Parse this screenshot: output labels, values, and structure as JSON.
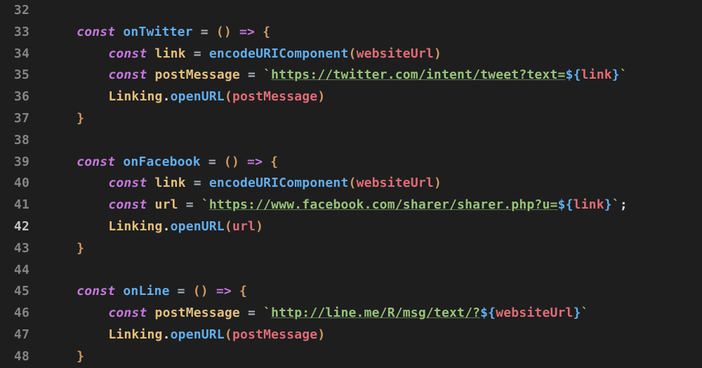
{
  "editor": {
    "font": "Menlo / SF Mono",
    "filename": "share.js",
    "language": "javascript/jsx",
    "indent_unit": "  ",
    "active_line": 42
  },
  "lines": [
    {
      "n": 32,
      "indent": 1,
      "tokens": []
    },
    {
      "n": 33,
      "indent": 1,
      "tokens": [
        {
          "c": "tok-kw",
          "t": "const"
        },
        {
          "c": "tok-pun",
          "t": " "
        },
        {
          "c": "tok-call",
          "t": "onTwitter"
        },
        {
          "c": "tok-pun",
          "t": " "
        },
        {
          "c": "tok-op",
          "t": "="
        },
        {
          "c": "tok-pun",
          "t": " "
        },
        {
          "c": "tok-paren",
          "t": "()"
        },
        {
          "c": "tok-pun",
          "t": " "
        },
        {
          "c": "tok-kw",
          "t": "=>"
        },
        {
          "c": "tok-pun",
          "t": " "
        },
        {
          "c": "tok-paren",
          "t": "{"
        }
      ]
    },
    {
      "n": 34,
      "indent": 2,
      "tokens": [
        {
          "c": "tok-kw",
          "t": "const"
        },
        {
          "c": "tok-pun",
          "t": " "
        },
        {
          "c": "tok-var",
          "t": "link"
        },
        {
          "c": "tok-pun",
          "t": " "
        },
        {
          "c": "tok-op",
          "t": "="
        },
        {
          "c": "tok-pun",
          "t": " "
        },
        {
          "c": "tok-call",
          "t": "encodeURIComponent"
        },
        {
          "c": "tok-paren",
          "t": "("
        },
        {
          "c": "tok-red",
          "t": "websiteUrl"
        },
        {
          "c": "tok-paren",
          "t": ")"
        }
      ]
    },
    {
      "n": 35,
      "indent": 2,
      "tokens": [
        {
          "c": "tok-kw",
          "t": "const"
        },
        {
          "c": "tok-pun",
          "t": " "
        },
        {
          "c": "tok-var",
          "t": "postMessage"
        },
        {
          "c": "tok-pun",
          "t": " "
        },
        {
          "c": "tok-op",
          "t": "="
        },
        {
          "c": "tok-pun",
          "t": " "
        },
        {
          "c": "tok-str",
          "t": "`"
        },
        {
          "c": "tok-url",
          "t": "https://twitter.com/intent/tweet?text="
        },
        {
          "c": "tok-tpl",
          "t": "${"
        },
        {
          "c": "tok-red",
          "t": "link"
        },
        {
          "c": "tok-tpl",
          "t": "}"
        },
        {
          "c": "tok-str",
          "t": "`"
        }
      ]
    },
    {
      "n": 36,
      "indent": 2,
      "tokens": [
        {
          "c": "tok-var",
          "t": "Linking"
        },
        {
          "c": "tok-pun",
          "t": "."
        },
        {
          "c": "tok-call",
          "t": "openURL"
        },
        {
          "c": "tok-paren",
          "t": "("
        },
        {
          "c": "tok-red",
          "t": "postMessage"
        },
        {
          "c": "tok-paren",
          "t": ")"
        }
      ]
    },
    {
      "n": 37,
      "indent": 1,
      "tokens": [
        {
          "c": "tok-paren",
          "t": "}"
        }
      ]
    },
    {
      "n": 38,
      "indent": 0,
      "tokens": []
    },
    {
      "n": 39,
      "indent": 1,
      "tokens": [
        {
          "c": "tok-kw",
          "t": "const"
        },
        {
          "c": "tok-pun",
          "t": " "
        },
        {
          "c": "tok-call",
          "t": "onFacebook"
        },
        {
          "c": "tok-pun",
          "t": " "
        },
        {
          "c": "tok-op",
          "t": "="
        },
        {
          "c": "tok-pun",
          "t": " "
        },
        {
          "c": "tok-paren",
          "t": "()"
        },
        {
          "c": "tok-pun",
          "t": " "
        },
        {
          "c": "tok-kw",
          "t": "=>"
        },
        {
          "c": "tok-pun",
          "t": " "
        },
        {
          "c": "tok-paren",
          "t": "{"
        }
      ]
    },
    {
      "n": 40,
      "indent": 2,
      "tokens": [
        {
          "c": "tok-kw",
          "t": "const"
        },
        {
          "c": "tok-pun",
          "t": " "
        },
        {
          "c": "tok-var",
          "t": "link"
        },
        {
          "c": "tok-pun",
          "t": " "
        },
        {
          "c": "tok-op",
          "t": "="
        },
        {
          "c": "tok-pun",
          "t": " "
        },
        {
          "c": "tok-call",
          "t": "encodeURIComponent"
        },
        {
          "c": "tok-paren",
          "t": "("
        },
        {
          "c": "tok-red",
          "t": "websiteUrl"
        },
        {
          "c": "tok-paren",
          "t": ")"
        }
      ]
    },
    {
      "n": 41,
      "indent": 2,
      "tokens": [
        {
          "c": "tok-kw",
          "t": "const"
        },
        {
          "c": "tok-pun",
          "t": " "
        },
        {
          "c": "tok-var",
          "t": "url"
        },
        {
          "c": "tok-pun",
          "t": " "
        },
        {
          "c": "tok-op",
          "t": "="
        },
        {
          "c": "tok-pun",
          "t": " "
        },
        {
          "c": "tok-str",
          "t": "`"
        },
        {
          "c": "tok-url",
          "t": "https://www.facebook.com/sharer/sharer.php?u="
        },
        {
          "c": "tok-tpl",
          "t": "${"
        },
        {
          "c": "tok-red",
          "t": "link"
        },
        {
          "c": "tok-tpl",
          "t": "}"
        },
        {
          "c": "tok-str",
          "t": "`"
        },
        {
          "c": "tok-pun",
          "t": ";"
        }
      ]
    },
    {
      "n": 42,
      "indent": 2,
      "tokens": [
        {
          "c": "tok-var",
          "t": "Linking"
        },
        {
          "c": "tok-pun",
          "t": "."
        },
        {
          "c": "tok-call",
          "t": "openURL"
        },
        {
          "c": "tok-paren",
          "t": "("
        },
        {
          "c": "tok-red",
          "t": "url"
        },
        {
          "c": "tok-paren",
          "t": ")"
        }
      ]
    },
    {
      "n": 43,
      "indent": 1,
      "tokens": [
        {
          "c": "tok-paren",
          "t": "}"
        }
      ]
    },
    {
      "n": 44,
      "indent": 0,
      "tokens": []
    },
    {
      "n": 45,
      "indent": 1,
      "tokens": [
        {
          "c": "tok-kw",
          "t": "const"
        },
        {
          "c": "tok-pun",
          "t": " "
        },
        {
          "c": "tok-call",
          "t": "onLine"
        },
        {
          "c": "tok-pun",
          "t": " "
        },
        {
          "c": "tok-op",
          "t": "="
        },
        {
          "c": "tok-pun",
          "t": " "
        },
        {
          "c": "tok-paren",
          "t": "()"
        },
        {
          "c": "tok-pun",
          "t": " "
        },
        {
          "c": "tok-kw",
          "t": "=>"
        },
        {
          "c": "tok-pun",
          "t": " "
        },
        {
          "c": "tok-paren",
          "t": "{"
        }
      ]
    },
    {
      "n": 46,
      "indent": 2,
      "tokens": [
        {
          "c": "tok-kw",
          "t": "const"
        },
        {
          "c": "tok-pun",
          "t": " "
        },
        {
          "c": "tok-var",
          "t": "postMessage"
        },
        {
          "c": "tok-pun",
          "t": " "
        },
        {
          "c": "tok-op",
          "t": "="
        },
        {
          "c": "tok-pun",
          "t": " "
        },
        {
          "c": "tok-str",
          "t": "`"
        },
        {
          "c": "tok-url",
          "t": "http://line.me/R/msg/text/?"
        },
        {
          "c": "tok-tpl",
          "t": "${"
        },
        {
          "c": "tok-red",
          "t": "websiteUrl"
        },
        {
          "c": "tok-tpl",
          "t": "}"
        },
        {
          "c": "tok-str",
          "t": "`"
        }
      ]
    },
    {
      "n": 47,
      "indent": 2,
      "tokens": [
        {
          "c": "tok-var",
          "t": "Linking"
        },
        {
          "c": "tok-pun",
          "t": "."
        },
        {
          "c": "tok-call",
          "t": "openURL"
        },
        {
          "c": "tok-paren",
          "t": "("
        },
        {
          "c": "tok-red",
          "t": "postMessage"
        },
        {
          "c": "tok-paren",
          "t": ")"
        }
      ]
    },
    {
      "n": 48,
      "indent": 1,
      "tokens": [
        {
          "c": "tok-paren",
          "t": "}"
        }
      ]
    }
  ]
}
